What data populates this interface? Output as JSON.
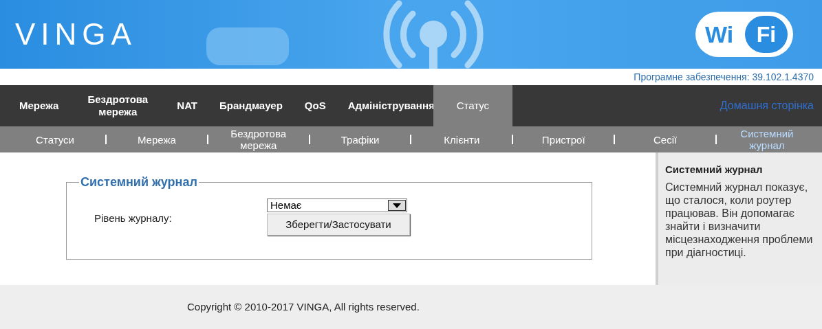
{
  "header": {
    "logo": "VINGA",
    "wifi_badge": [
      "Wi",
      "Fi"
    ],
    "firmware": "Програмне забезпечення: 39.102.1.4370"
  },
  "nav": {
    "items": [
      {
        "label": "Мережа",
        "selected": false
      },
      {
        "label": "Бездротова мережа",
        "selected": false
      },
      {
        "label": "NAT",
        "selected": false
      },
      {
        "label": "Брандмауер",
        "selected": false
      },
      {
        "label": "QoS",
        "selected": false
      },
      {
        "label": "Адміністрування",
        "selected": false
      },
      {
        "label": "Статус",
        "selected": true
      }
    ],
    "home_link": "Домашня сторінка"
  },
  "subnav": {
    "items": [
      {
        "label": "Статуси",
        "selected": false
      },
      {
        "label": "Мережа",
        "selected": false
      },
      {
        "label": "Бездротова мережа",
        "selected": false
      },
      {
        "label": "Трафіки",
        "selected": false
      },
      {
        "label": "Клієнти",
        "selected": false
      },
      {
        "label": "Пристрої",
        "selected": false
      },
      {
        "label": "Сесії",
        "selected": false
      },
      {
        "label": "Системний журнал",
        "selected": true
      }
    ]
  },
  "panel": {
    "legend": "Системний журнал",
    "field_label": "Рівень журналу:",
    "select_value": "Немає",
    "button": "Зберегти/Застосувати"
  },
  "help": {
    "title": "Системний журнал",
    "text": "Системний журнал показує, що сталося, коли роутер працював. Він допомагає знайти і визначити місцезнаходження проблеми при діагностиці."
  },
  "footer": "Copyright © 2010-2017 VINGA, All rights reserved."
}
